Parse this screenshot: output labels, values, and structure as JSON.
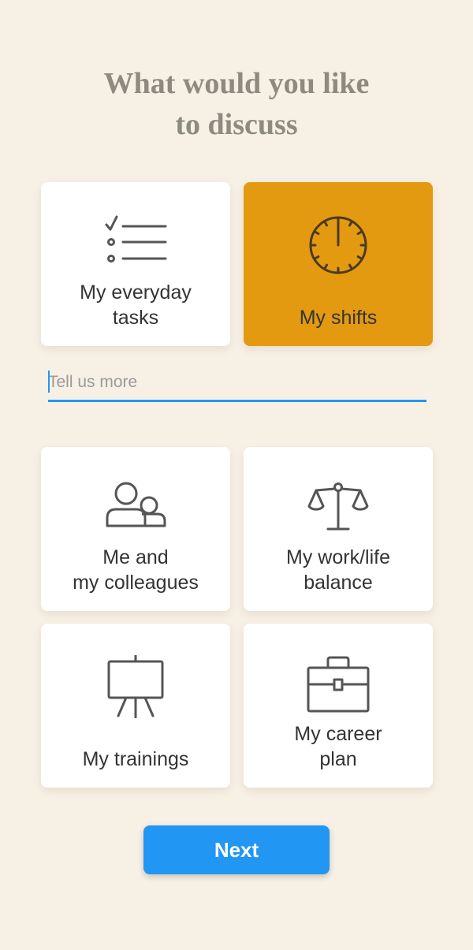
{
  "header": {
    "title_line1": "What would you like",
    "title_line2": "to discuss"
  },
  "topics": [
    {
      "line1": "My everyday",
      "line2": "tasks",
      "icon": "checklist-icon",
      "selected": false
    },
    {
      "line1": "My shifts",
      "line2": "",
      "icon": "clock-icon",
      "selected": true
    },
    {
      "line1": "Me and",
      "line2": "my colleagues",
      "icon": "people-icon",
      "selected": false
    },
    {
      "line1": "My work/life",
      "line2": "balance",
      "icon": "scale-icon",
      "selected": false
    },
    {
      "line1": "My trainings",
      "line2": "",
      "icon": "easel-icon",
      "selected": false
    },
    {
      "line1": "My career",
      "line2": "plan",
      "icon": "briefcase-icon",
      "selected": false
    }
  ],
  "details": {
    "placeholder": "Tell us more",
    "value": ""
  },
  "footer": {
    "next_label": "Next"
  },
  "colors": {
    "background": "#f7f0e5",
    "selected_card": "#e39a10",
    "accent": "#2196f3",
    "title": "#8d8a7f"
  }
}
